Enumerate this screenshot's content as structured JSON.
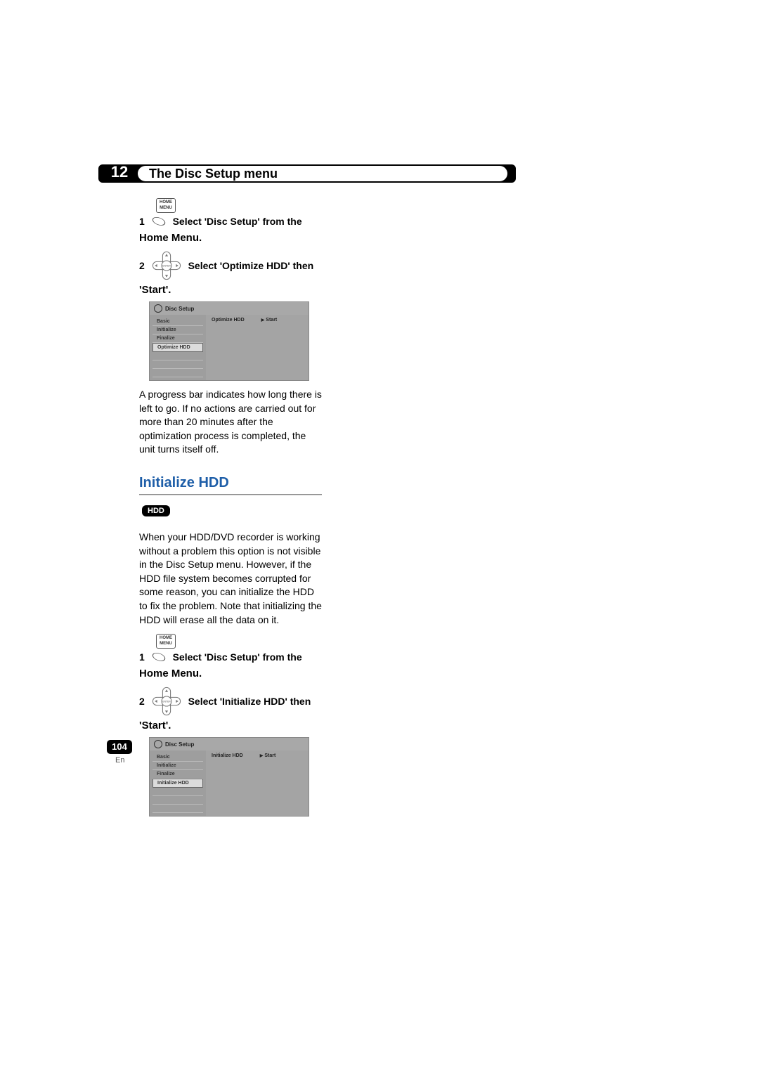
{
  "chapter": {
    "number": "12",
    "title": "The Disc Setup menu"
  },
  "icons": {
    "home_menu_line1": "HOME",
    "home_menu_line2": "MENU",
    "enter_label": "ENTER"
  },
  "optimize": {
    "step1": {
      "num": "1",
      "text": "Select 'Disc Setup' from the",
      "cont": "Home Menu."
    },
    "step2": {
      "num": "2",
      "text": "Select 'Optimize HDD' then",
      "cont": "'Start'."
    },
    "ui": {
      "header": "Disc Setup",
      "sidebar": [
        "Basic",
        "Initialize",
        "Finalize",
        "Optimize HDD"
      ],
      "selected_index": 3,
      "pane_label": "Optimize HDD",
      "pane_action": "Start"
    },
    "body": "A progress bar indicates how long there is left to go. If no actions are carried out for more than 20 minutes after the optimization process is completed, the unit turns itself off."
  },
  "initialize": {
    "heading": "Initialize HDD",
    "badge": "HDD",
    "intro": "When your HDD/DVD recorder is working without a problem this option is not visible in the Disc Setup menu. However, if the HDD file system becomes corrupted for some reason, you can initialize the HDD to fix the problem. Note that initializing the HDD will erase all the data on it.",
    "step1": {
      "num": "1",
      "text": "Select 'Disc Setup' from the",
      "cont": "Home Menu."
    },
    "step2": {
      "num": "2",
      "text": "Select 'Initialize HDD' then",
      "cont": "'Start'."
    },
    "ui": {
      "header": "Disc Setup",
      "sidebar": [
        "Basic",
        "Initialize",
        "Finalize",
        "Initialize HDD"
      ],
      "selected_index": 3,
      "pane_label": "Initialize HDD",
      "pane_action": "Start"
    }
  },
  "footer": {
    "page_num": "104",
    "lang": "En"
  }
}
